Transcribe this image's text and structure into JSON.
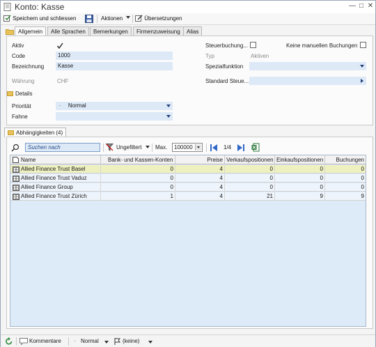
{
  "window": {
    "title": "Konto: Kasse"
  },
  "toolbar": {
    "save_close": "Speichern und schliessen",
    "actions": "Aktionen",
    "translations": "Übersetzungen"
  },
  "tabs": [
    "Allgemein",
    "Alle Sprachen",
    "Bemerkungen",
    "Firmenzuweisung",
    "Alias"
  ],
  "general": {
    "active_label": "Aktiv",
    "code_label": "Code",
    "code_value": "1000",
    "name_label": "Bezeichnung",
    "name_value": "Kasse",
    "currency_label": "Währung",
    "currency_value": "CHF",
    "tax_booking_label": "Steuerbuchung...",
    "no_manual_label": "Keine manuellen Buchungen",
    "type_label": "Typ",
    "type_value": "Aktiven",
    "special_label": "Spezialfunktion",
    "standard_tax_label": "Standard Steue..."
  },
  "details": {
    "header": "Details",
    "priority_label": "Priorität",
    "priority_value": "Normal",
    "priority_prefix": "·",
    "flag_label": "Fahne"
  },
  "dependencies": {
    "tab_label": "Abhängigkeiten (4)",
    "search_placeholder": "Suchen nach",
    "filter_label": "Ungefiltert",
    "max_label": "Max.",
    "max_value": "100000",
    "page_label": "1/4",
    "columns": [
      "Name",
      "Bank- und Kassen-Konten",
      "Preise",
      "Verkaufspositionen",
      "Einkaufspositionen",
      "Buchungen"
    ],
    "rows": [
      {
        "name": "Allied Finance Trust Basel",
        "bank": "0",
        "prices": "4",
        "sales": "0",
        "purchases": "0",
        "bookings": "0"
      },
      {
        "name": "Allied Finance Trust Vaduz",
        "bank": "0",
        "prices": "4",
        "sales": "0",
        "purchases": "0",
        "bookings": "0"
      },
      {
        "name": "Allied Finance Group",
        "bank": "0",
        "prices": "4",
        "sales": "0",
        "purchases": "0",
        "bookings": "0"
      },
      {
        "name": "Allied Finance Trust Zürich",
        "bank": "1",
        "prices": "4",
        "sales": "21",
        "purchases": "9",
        "bookings": "9"
      }
    ]
  },
  "statusbar": {
    "comments": "Kommentare",
    "priority": "Normal",
    "flag": "(keine)"
  },
  "colors": {
    "field_bg": "#dde9f7",
    "selected_row": "#eef0c0",
    "grid_bg": "#ddeaf8",
    "accent": "#23407a"
  }
}
